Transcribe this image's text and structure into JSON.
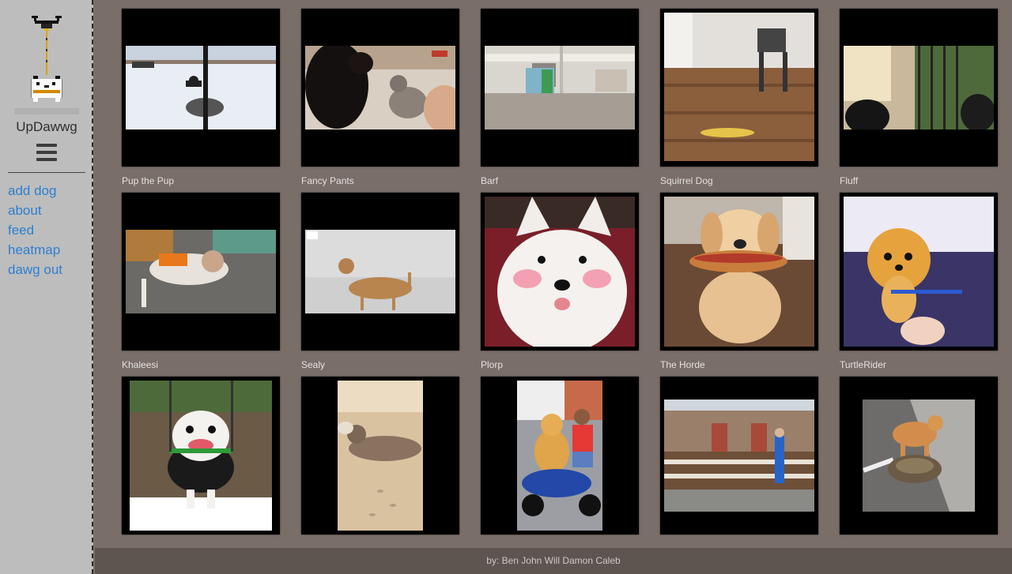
{
  "app": {
    "title": "UpDawwg",
    "logo_icon": "pixel-dog-drone-icon",
    "menu_icon": "hamburger-menu-icon"
  },
  "nav": {
    "items": [
      {
        "label": "add dog"
      },
      {
        "label": "about"
      },
      {
        "label": "feed"
      },
      {
        "label": "heatmap"
      },
      {
        "label": "dawg out"
      }
    ]
  },
  "dogs": [
    {
      "caption": "Pup the Pup"
    },
    {
      "caption": "Fancy Pants"
    },
    {
      "caption": "Barf"
    },
    {
      "caption": "Squirrel Dog"
    },
    {
      "caption": "Fluff"
    },
    {
      "caption": "Khaleesi"
    },
    {
      "caption": "Sealy"
    },
    {
      "caption": "Plorp"
    },
    {
      "caption": "The Horde"
    },
    {
      "caption": "TurtleRider"
    },
    {
      "caption": ""
    },
    {
      "caption": ""
    },
    {
      "caption": ""
    },
    {
      "caption": ""
    },
    {
      "caption": ""
    }
  ],
  "footer": {
    "text": "by: Ben John Will Damon Caleb"
  },
  "colors": {
    "link": "#2d7fd0",
    "sidebar_bg": "#bdbdbd",
    "main_bg": "#7a6e69",
    "footer_bg": "#5e5450"
  }
}
